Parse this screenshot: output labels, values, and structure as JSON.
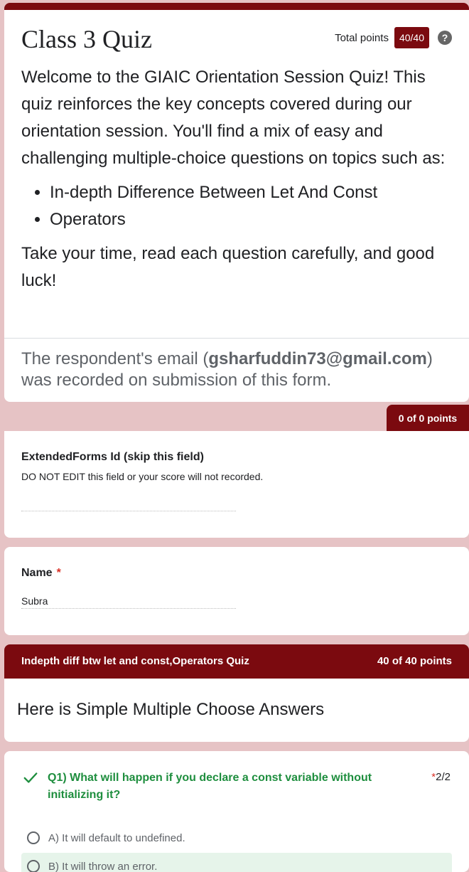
{
  "header": {
    "form_title": "Class 3 Quiz",
    "points_label": "Total points",
    "points_value": "40/40",
    "help_icon": "?",
    "description_intro": "Welcome to the GIAIC Orientation Session Quiz! This quiz reinforces the key concepts covered during our orientation session. You'll find a mix of easy and challenging multiple-choice questions on topics such as:",
    "topics": [
      "In-depth Difference Between Let And Const",
      "Operators"
    ],
    "description_outro": "Take your time, read each question carefully, and good luck!",
    "email_note_prefix": "The respondent's email (",
    "email": "gsharfuddin73@gmail.com",
    "email_note_suffix": ") was recorded on submission of this form."
  },
  "section1": {
    "points": "0 of 0 points"
  },
  "extended_field": {
    "title": "ExtendedForms Id (skip this field)",
    "description": "DO NOT EDIT this field or your score will not recorded.",
    "value": ""
  },
  "name_field": {
    "title": "Name",
    "required_mark": "*",
    "value": "Subra"
  },
  "section2": {
    "title": "Indepth diff btw let and const,Operators Quiz",
    "points": "40 of 40 points",
    "heading": "Here is Simple Multiple Choose Answers"
  },
  "q1": {
    "text": "Q1)  What will happen if you declare a const variable without initializing it?",
    "required_mark": "*",
    "score": "2/2",
    "options": [
      {
        "label": "A) It will default to undefined."
      },
      {
        "label": "B) It will throw an error."
      }
    ],
    "colors": {
      "correct": "#1e8e3e",
      "accent": "#7b0a0f"
    }
  }
}
